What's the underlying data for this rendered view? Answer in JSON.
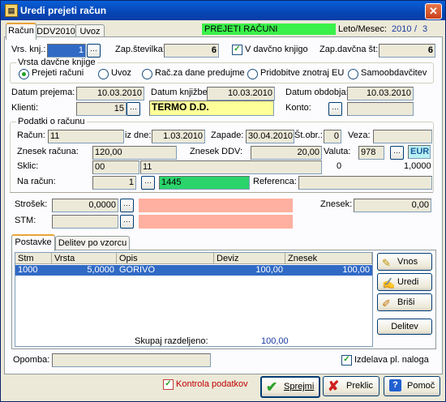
{
  "window": {
    "title": "Uredi prejeti račun",
    "close_glyph": "✕"
  },
  "tabs": [
    "Račun",
    "DDV2010",
    "Uvoz"
  ],
  "header": {
    "badge": "PREJETI RAČUNI",
    "period_label": "Leto/Mesec:",
    "year": "2010",
    "slash": "/",
    "month": "3"
  },
  "row1": {
    "vrs_label": "Vrs. knj.:",
    "vrs_value": "1",
    "zap_label": "Zap.številka:",
    "zap_value": "6",
    "davcno_label": "V davčno knjigo",
    "davcno_checked": true,
    "zapd_label": "Zap.davčna št:",
    "zapd_value": "6"
  },
  "vrsta": {
    "title": "Vrsta davčne knjige",
    "options": [
      "Prejeti računi",
      "Uvoz",
      "Rač.za dane predujme",
      "Pridobitve znotraj EU",
      "Samoobdavčitev"
    ],
    "selected": 0
  },
  "dates": {
    "prejem_label": "Datum prejema:",
    "prejem": "10.03.2010",
    "knjizba_label": "Datum knjižbe:",
    "knjizba": "10.03.2010",
    "obdobje_label": "Datum obdobja:",
    "obdobje": "10.03.2010"
  },
  "klient": {
    "label": "Klienti:",
    "id": "15",
    "name": "TERMO D.D.",
    "konto_label": "Konto:",
    "konto": ""
  },
  "podatki": {
    "title": "Podatki o računu",
    "racun_label": "Račun:",
    "racun": "11",
    "izdne_label": "iz dne:",
    "izdne": "1.03.2010",
    "zapade_label": "Zapade:",
    "zapade": "30.04.2010",
    "stobr_label": "Št.obr.:",
    "stobr": "0",
    "veza_label": "Veza:",
    "veza": "",
    "znesek_label": "Znesek računa:",
    "znesek": "120,00",
    "ddv_label": "Znesek DDV:",
    "ddv": "20,00",
    "valuta_label": "Valuta:",
    "valuta_code": "978",
    "valuta": "EUR",
    "sklic_label": "Sklic:",
    "sklic1": "00",
    "sklic2": "11",
    "zero": "0",
    "tecaj": "1,0000",
    "naracun_label": "Na račun:",
    "naracun_id": "1",
    "naracun": "1445",
    "referenca_label": "Referenca:",
    "referenca": ""
  },
  "strosek": {
    "label": "Strošek:",
    "value": "0,0000",
    "stm_label": "STM:",
    "stm": "",
    "znesek_label": "Znesek:",
    "znesek": "0,00"
  },
  "subtabs": [
    "Postavke",
    "Delitev po vzorcu"
  ],
  "grid": {
    "columns": [
      "Stm",
      "Vrsta",
      "Opis",
      "Deviz",
      "Znesek"
    ],
    "rows": [
      {
        "stm": "1000",
        "vrsta": "5,0000",
        "opis": "GORIVO",
        "deviz": "100,00",
        "znesek": "100,00"
      }
    ]
  },
  "side_buttons": [
    "Vnos",
    "Uredi",
    "Briši",
    "Delitev"
  ],
  "skupaj": {
    "label": "Skupaj razdeljeno:",
    "value": "100,00"
  },
  "opomba": {
    "label": "Opomba:",
    "value": ""
  },
  "izdelava": {
    "label": "Izdelava pl. naloga",
    "checked": true
  },
  "kontrola": {
    "label": "Kontrola podatkov",
    "checked": true
  },
  "bottom_buttons": [
    "Sprejmi",
    "Preklic",
    "Pomoč"
  ],
  "colors": {
    "badge": "#3af04a",
    "client": "#ffff99",
    "account": "#2bd36b",
    "salmon": "#ffb0a0",
    "eur": "#b9f0f4",
    "selected_row": "#316ac5"
  }
}
